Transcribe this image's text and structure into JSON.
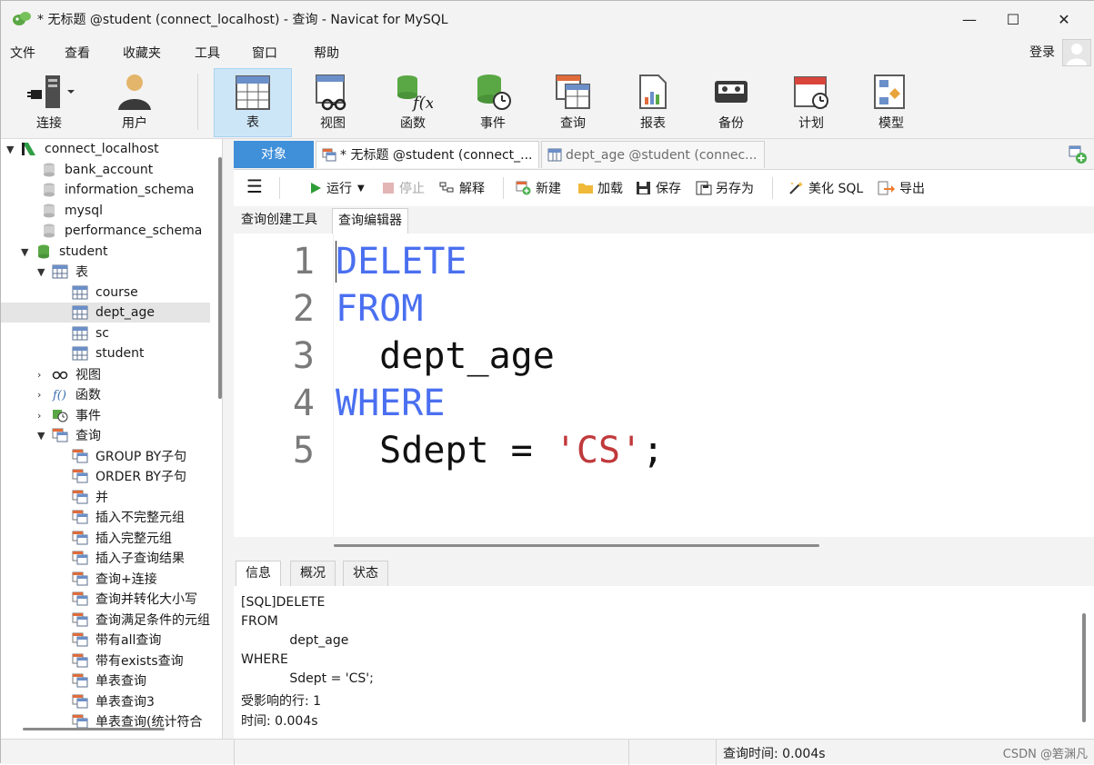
{
  "window": {
    "title": "* 无标题 @student (connect_localhost) - 查询 - Navicat for MySQL",
    "minimize": "—",
    "maximize": "☐",
    "close": "✕"
  },
  "menu": {
    "items": [
      "文件",
      "查看",
      "收藏夹",
      "工具",
      "窗口",
      "帮助"
    ],
    "login": "登录"
  },
  "toolbar": {
    "buttons": [
      {
        "label": "连接",
        "icon": "connect-icon"
      },
      {
        "label": "用户",
        "icon": "user-icon"
      },
      {
        "label": "表",
        "icon": "table-icon",
        "active": true
      },
      {
        "label": "视图",
        "icon": "view-icon"
      },
      {
        "label": "函数",
        "icon": "function-icon"
      },
      {
        "label": "事件",
        "icon": "event-icon"
      },
      {
        "label": "查询",
        "icon": "query-icon"
      },
      {
        "label": "报表",
        "icon": "report-icon"
      },
      {
        "label": "备份",
        "icon": "backup-icon"
      },
      {
        "label": "计划",
        "icon": "schedule-icon"
      },
      {
        "label": "模型",
        "icon": "model-icon"
      }
    ]
  },
  "tree": {
    "connection": "connect_localhost",
    "databases": [
      "bank_account",
      "information_schema",
      "mysql",
      "performance_schema",
      "student"
    ],
    "tables_group": "表",
    "tables": [
      "course",
      "dept_age",
      "sc",
      "student"
    ],
    "selected_table": "dept_age",
    "views_group": "视图",
    "functions_group": "函数",
    "events_group": "事件",
    "queries_group": "查询",
    "queries": [
      "GROUP BY子句",
      "ORDER BY子句",
      "并",
      "插入不完整元组",
      "插入完整元组",
      "插入子查询结果",
      "查询+连接",
      "查询并转化大小写",
      "查询满足条件的元组",
      "带有all查询",
      "带有exists查询",
      "单表查询",
      "单表查询3",
      "单表查询(统计符合"
    ]
  },
  "tabs": {
    "objects": "对象",
    "tab1": "* 无标题 @student (connect_...",
    "tab2": "dept_age @student (connec..."
  },
  "query_toolbar": {
    "menu": "☰",
    "run": "运行",
    "stop": "停止",
    "explain": "解释",
    "new": "新建",
    "load": "加载",
    "save": "保存",
    "save_as": "另存为",
    "beautify": "美化 SQL",
    "export": "导出"
  },
  "sub_tabs": {
    "builder": "查询创建工具",
    "editor": "查询编辑器"
  },
  "editor": {
    "line_numbers": [
      "1",
      "2",
      "3",
      "4",
      "5"
    ],
    "line1_kw": "DELETE",
    "line2_kw": "FROM",
    "line3": "  dept_age",
    "line4_kw": "WHERE",
    "line5_pre": "  Sdept = ",
    "line5_str": "'CS'",
    "line5_post": ";"
  },
  "bottom_tabs": {
    "info": "信息",
    "overview": "概况",
    "status": "状态"
  },
  "messages": [
    "[SQL]DELETE",
    "FROM",
    "            dept_age",
    "WHERE",
    "            Sdept = 'CS';",
    "受影响的行: 1",
    "时间: 0.004s"
  ],
  "statusbar": {
    "query_time": "查询时间: 0.004s",
    "watermark": "CSDN @箬渊凡"
  },
  "colors": {
    "keyword": "#4a6ff0",
    "string": "#c0393b",
    "accent": "#3f8fd9",
    "active_toolbar": "#cde6f7"
  }
}
